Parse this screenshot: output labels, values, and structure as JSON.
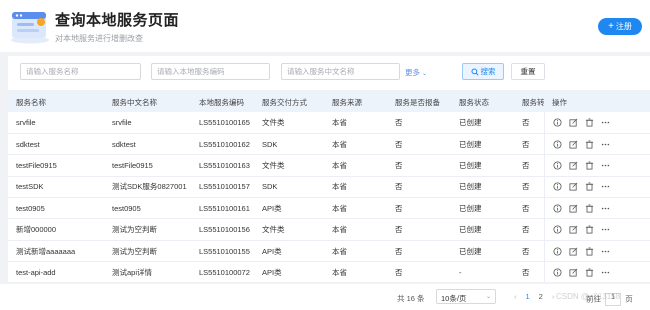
{
  "header": {
    "title": "查询本地服务页面",
    "subtitle": "对本地服务进行增删改查",
    "register_label": "注册",
    "logo_icon": "browser-window-icon",
    "accent": "#1e88f0"
  },
  "filter": {
    "service_name_placeholder": "请输入服务名称",
    "service_code_placeholder": "请输入本地服务编码",
    "service_cn_name_placeholder": "请输入服务中文名称",
    "more_label": "更多",
    "search_label": "搜索",
    "reset_label": "重置"
  },
  "table": {
    "columns": [
      "服务名称",
      "服务中文名称",
      "本地服务编码",
      "服务交付方式",
      "服务来源",
      "服务是否报备",
      "服务状态",
      "服务转",
      "操作"
    ],
    "rows": [
      [
        "srvfile",
        "srvfile",
        "LS5510100165",
        "文件类",
        "本省",
        "否",
        "已创建",
        "否"
      ],
      [
        "sdktest",
        "sdktest",
        "LS5510100162",
        "SDK",
        "本省",
        "否",
        "已创建",
        "否"
      ],
      [
        "testFile0915",
        "testFile0915",
        "LS5510100163",
        "文件类",
        "本省",
        "否",
        "已创建",
        "否"
      ],
      [
        "testSDK",
        "测试SDK服务0827001",
        "LS5510100157",
        "SDK",
        "本省",
        "否",
        "已创建",
        "否"
      ],
      [
        "test0905",
        "test0905",
        "LS5510100161",
        "API类",
        "本省",
        "否",
        "已创建",
        "否"
      ],
      [
        "新增000000",
        "测试为空判断",
        "LS5510100156",
        "文件类",
        "本省",
        "否",
        "已创建",
        "否"
      ],
      [
        "测试新增aaaaaaa",
        "测试为空判断",
        "LS5510100155",
        "API类",
        "本省",
        "否",
        "已创建",
        "否"
      ],
      [
        "test-api-add",
        "测试api详情",
        "LS5510100072",
        "API类",
        "本省",
        "否",
        "-",
        "否"
      ]
    ]
  },
  "pagination": {
    "total_text": "共 16 条",
    "page_size": "10条/页",
    "pages": [
      "1",
      "2"
    ],
    "current_page": "1",
    "goto_label": "前往",
    "goto_value": "1",
    "page_suffix": "页"
  },
  "watermark": "CSDN @u013158"
}
